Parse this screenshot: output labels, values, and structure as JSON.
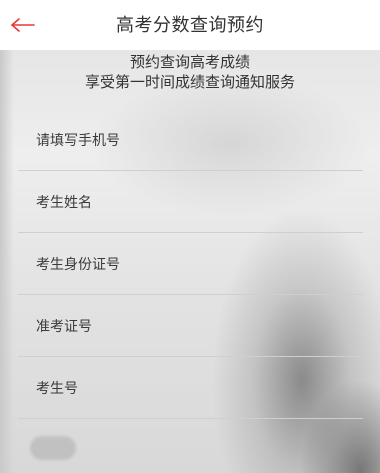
{
  "header": {
    "title": "高考分数查询预约"
  },
  "notice": {
    "line1": "预约查询高考成绩",
    "line2": "享受第一时间成绩查询通知服务"
  },
  "form": {
    "phone_placeholder": "请填写手机号",
    "name_placeholder": "考生姓名",
    "id_card_placeholder": "考生身份证号",
    "admission_ticket_placeholder": "准考证号",
    "candidate_number_placeholder": "考生号"
  },
  "colors": {
    "accent": "#e53935",
    "title_text": "#333333",
    "divider": "#cfcfcf"
  }
}
